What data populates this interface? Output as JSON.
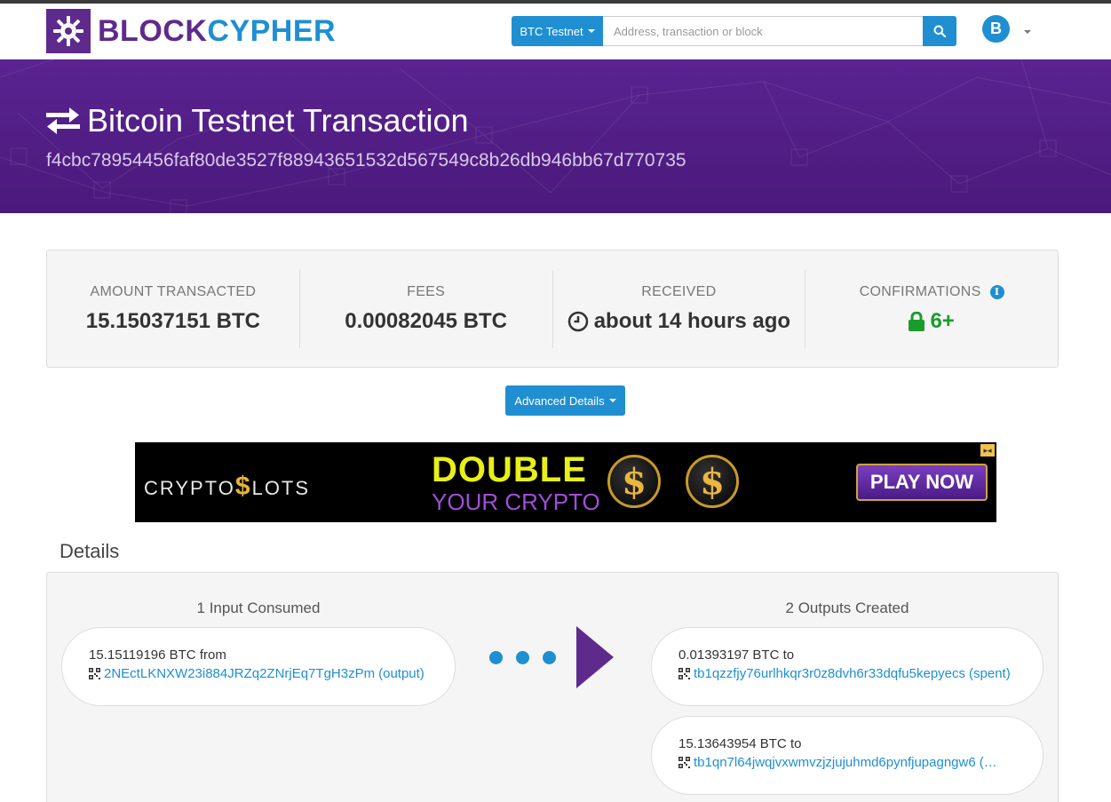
{
  "brand": {
    "part1": "BLOCK",
    "part2": "CYPHER"
  },
  "nav": {
    "network_label": "BTC Testnet",
    "search_placeholder": "Address, transaction or block",
    "coin_symbol": "B"
  },
  "hero": {
    "title": "Bitcoin Testnet Transaction",
    "hash": "f4cbc78954456faf80de3527f88943651532d567549c8b26db946bb67d770735"
  },
  "summary": {
    "amount_label": "AMOUNT TRANSACTED",
    "amount_value": "15.15037151 BTC",
    "fees_label": "FEES",
    "fees_value": "0.00082045 BTC",
    "received_label": "RECEIVED",
    "received_value": "about 14 hours ago",
    "confirmations_label": "CONFIRMATIONS",
    "confirmations_value": "6+"
  },
  "advanced_details_label": "Advanced Details",
  "ad": {
    "brand_a": "CRYPTO",
    "brand_s": "$",
    "brand_b": "LOTS",
    "headline": "DOUBLE",
    "subline": "YOUR CRYPTO",
    "coin_glyph": "$",
    "cta": "PLAY NOW"
  },
  "details": {
    "title": "Details",
    "inputs_header": "1 Input Consumed",
    "outputs_header": "2 Outputs Created",
    "inputs": [
      {
        "amount": "15.15119196 BTC",
        "preposition": "from",
        "address": "2NEctLKNXW23i884JRZq2ZNrjEq7TgH3zPm",
        "status": "(output)"
      }
    ],
    "outputs": [
      {
        "amount": "0.01393197 BTC",
        "preposition": "to",
        "address": "tb1qzzfjy76urlhkqr3r0z8dvh6r33dqfu5kepyecs",
        "status": "(spent)"
      },
      {
        "amount": "15.13643954 BTC",
        "preposition": "to",
        "address": "tb1qn7l64jwqjvxwmvzjzjujuhmd6pynfjupagngw6",
        "status": "(…"
      }
    ]
  },
  "colors": {
    "brand_purple": "#5e2a8c",
    "accent_blue": "#1f8fd1",
    "confirm_green": "#1a9c2c",
    "ad_yellow": "#e8f016",
    "ad_purple": "#a04ed8"
  }
}
